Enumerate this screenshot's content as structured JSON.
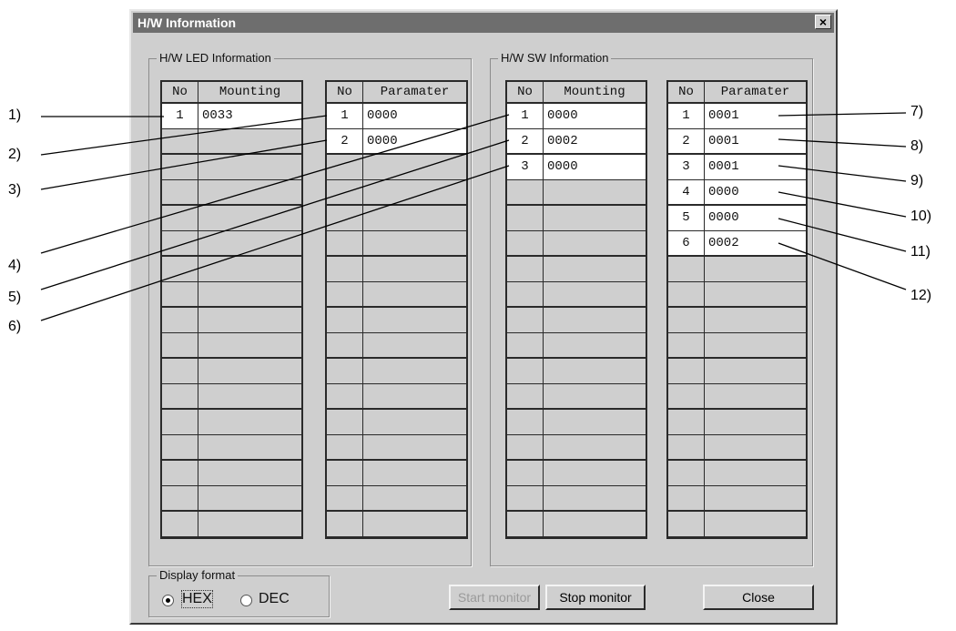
{
  "window": {
    "title": "H/W Information",
    "close_label": "×"
  },
  "led_group": {
    "title": "H/W LED Information",
    "mounting": {
      "headers": [
        "No",
        "Mounting"
      ],
      "rows": [
        [
          "1",
          "0033"
        ]
      ]
    },
    "parameter": {
      "headers": [
        "No",
        "Paramater"
      ],
      "rows": [
        [
          "1",
          "0000"
        ],
        [
          "2",
          "0000"
        ]
      ]
    }
  },
  "sw_group": {
    "title": "H/W SW Information",
    "mounting": {
      "headers": [
        "No",
        "Mounting"
      ],
      "rows": [
        [
          "1",
          "0000"
        ],
        [
          "2",
          "0002"
        ],
        [
          "3",
          "0000"
        ]
      ]
    },
    "parameter": {
      "headers": [
        "No",
        "Paramater"
      ],
      "rows": [
        [
          "1",
          "0001"
        ],
        [
          "2",
          "0001"
        ],
        [
          "3",
          "0001"
        ],
        [
          "4",
          "0000"
        ],
        [
          "5",
          "0000"
        ],
        [
          "6",
          "0002"
        ]
      ]
    }
  },
  "display_format": {
    "title": "Display format",
    "options": [
      "HEX",
      "DEC"
    ],
    "selected": "HEX"
  },
  "buttons": {
    "start_monitor": "Start monitor",
    "stop_monitor": "Stop monitor",
    "close": "Close"
  },
  "callouts": [
    "1)",
    "2)",
    "3)",
    "4)",
    "5)",
    "6)",
    "7)",
    "8)",
    "9)",
    "10)",
    "11)",
    "12)"
  ]
}
